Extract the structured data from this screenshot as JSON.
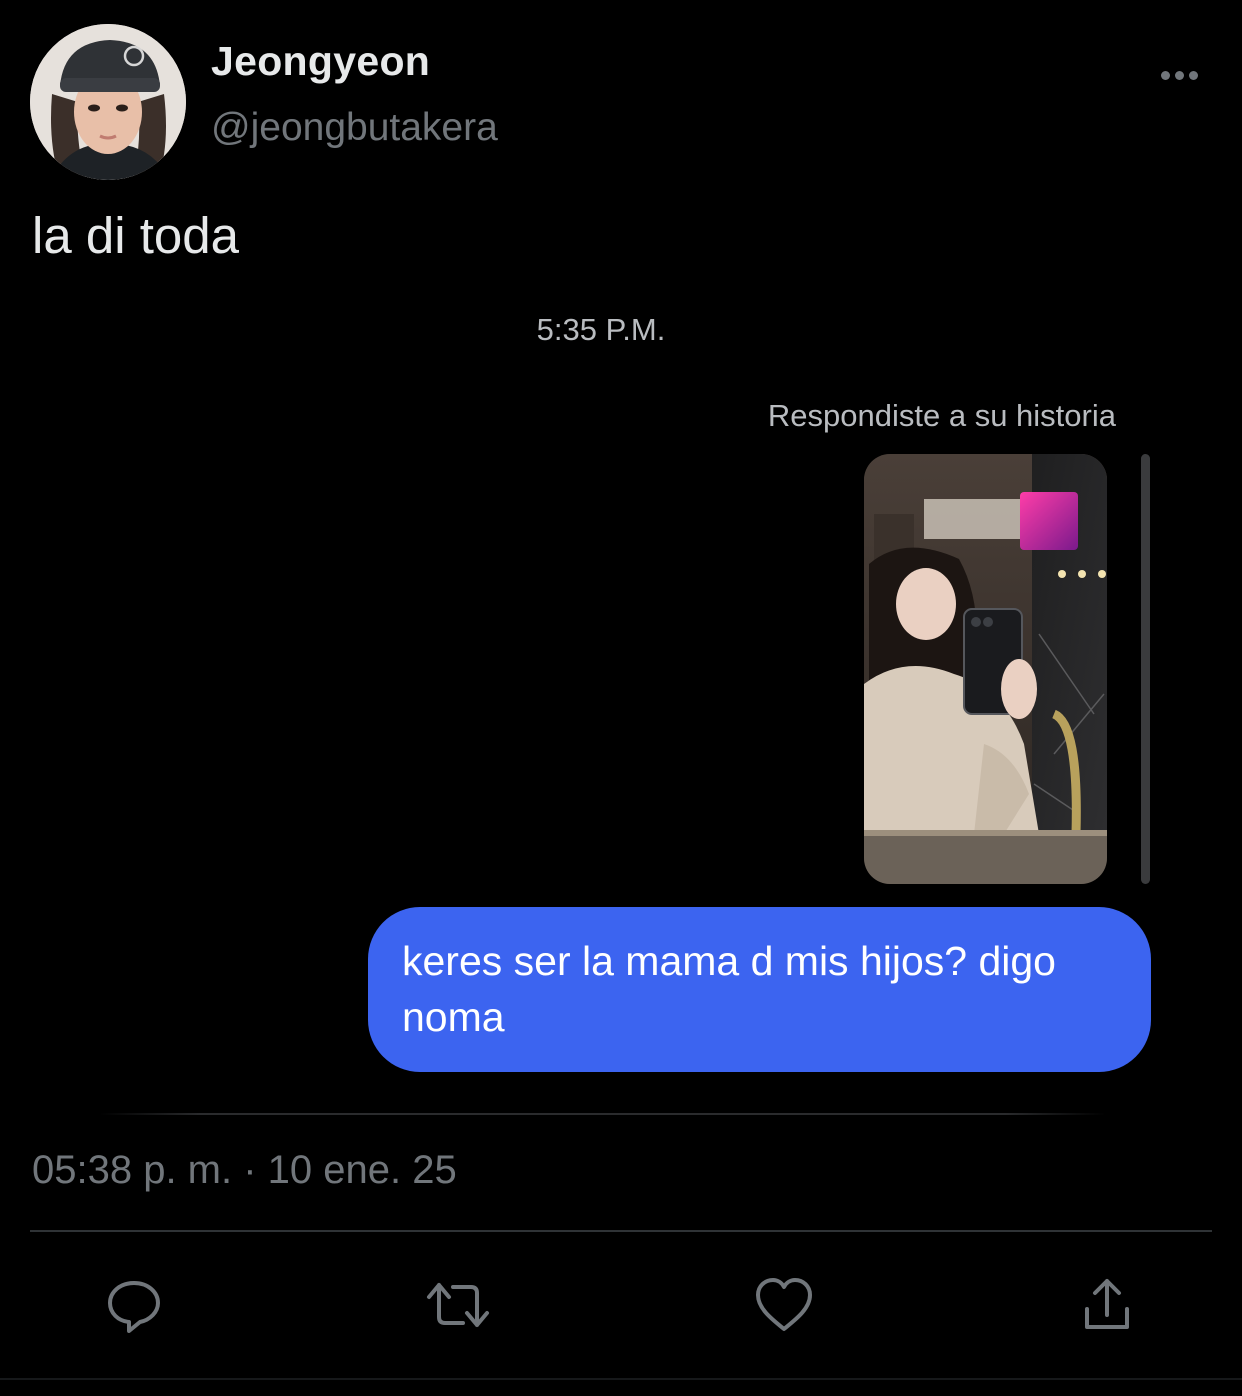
{
  "tweet": {
    "display_name": "Jeongyeon",
    "handle": "@jeongbutakera",
    "text": "la di toda",
    "timestamp": "05:38 p. m. · 10 ene. 25"
  },
  "dm": {
    "time": "5:35 P.M.",
    "replied_label": "Respondiste a su historia",
    "message": "keres ser la mama d mis hijos? digo noma"
  },
  "actions": {
    "reply_icon": "reply-icon",
    "retweet_icon": "retweet-icon",
    "like_icon": "heart-icon",
    "share_icon": "share-icon"
  },
  "colors": {
    "background": "#000000",
    "primary_text": "#e7e9ea",
    "secondary_text": "#71767b",
    "bubble": "#3c64f0"
  }
}
